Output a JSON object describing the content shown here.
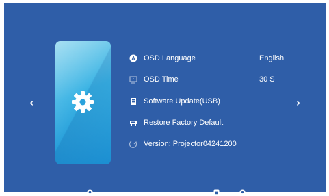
{
  "menu": {
    "items": [
      {
        "label": "OSD Language",
        "value": "English",
        "icon": "language-icon"
      },
      {
        "label": "OSD Time",
        "value": "30 S",
        "icon": "timer-icon"
      },
      {
        "label": "Software Update(USB)",
        "value": "",
        "icon": "usb-update-icon"
      },
      {
        "label": "Restore Factory Default",
        "value": "",
        "icon": "restore-icon"
      },
      {
        "label": "Version:  Projector04241200",
        "value": "",
        "icon": "version-icon"
      }
    ]
  },
  "nav": {
    "prev_glyph": "‹",
    "next_glyph": "›"
  },
  "colors": {
    "background": "#2f5ea8",
    "card": "#3ab3e4",
    "text": "#ffffff"
  },
  "bottom_icons": [
    "source-icon",
    "home-icon",
    "settings-icon"
  ]
}
